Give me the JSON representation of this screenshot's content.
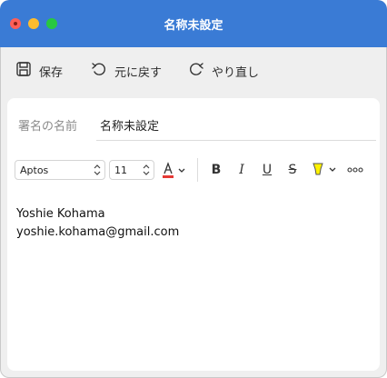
{
  "window": {
    "title": "名称未設定"
  },
  "toolbar": {
    "save_label": "保存",
    "undo_label": "元に戻す",
    "redo_label": "やり直し"
  },
  "signature": {
    "name_label": "署名の名前",
    "name_value": "名称未設定"
  },
  "format": {
    "font": "Aptos",
    "size": "11",
    "text_color": "#e53935",
    "highlight_color": "#fff200"
  },
  "body": {
    "line1": "Yoshie Kohama",
    "line2": "yoshie.kohama@gmail.com"
  }
}
